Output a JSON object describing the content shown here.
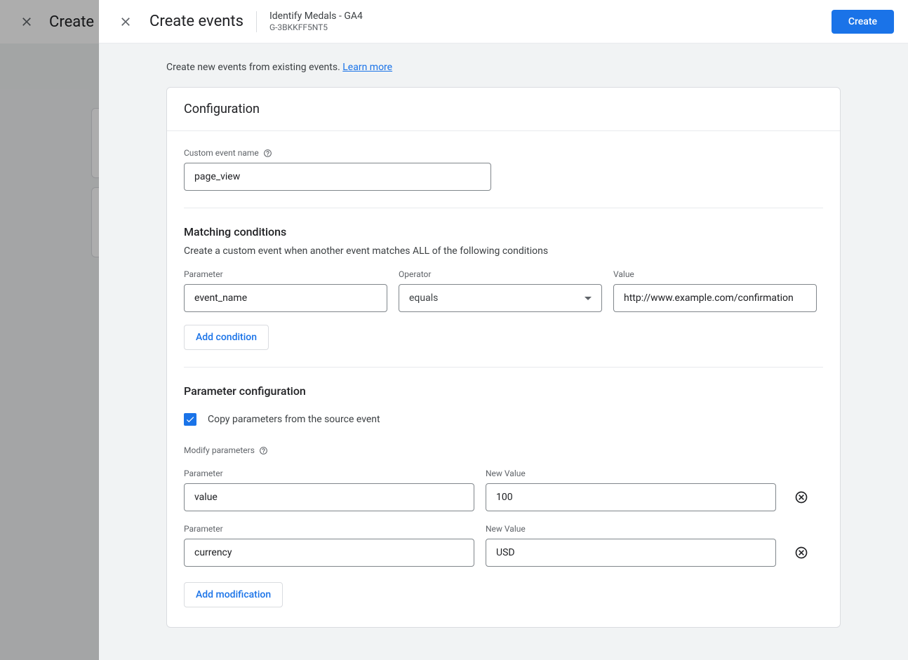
{
  "background": {
    "title": "Create"
  },
  "header": {
    "title": "Create events",
    "property_name": "Identify Medals - GA4",
    "property_id": "G-3BKKFF5NT5",
    "create_button": "Create"
  },
  "intro": {
    "text": "Create new events from existing events. ",
    "link": "Learn more"
  },
  "config": {
    "section_title": "Configuration",
    "custom_event": {
      "label": "Custom event name",
      "value": "page_view"
    },
    "matching": {
      "title": "Matching conditions",
      "description": "Create a custom event when another event matches ALL of the following conditions",
      "parameter_label": "Parameter",
      "operator_label": "Operator",
      "value_label": "Value",
      "condition": {
        "parameter": "event_name",
        "operator": "equals",
        "value": "http://www.example.com/confirmation"
      },
      "add_button": "Add condition"
    },
    "param_config": {
      "title": "Parameter configuration",
      "copy_checkbox_label": "Copy parameters from the source event",
      "modify_label": "Modify parameters",
      "parameter_label": "Parameter",
      "new_value_label": "New Value",
      "rows": [
        {
          "parameter": "value",
          "new_value": "100"
        },
        {
          "parameter": "currency",
          "new_value": "USD"
        }
      ],
      "add_button": "Add modification"
    }
  }
}
